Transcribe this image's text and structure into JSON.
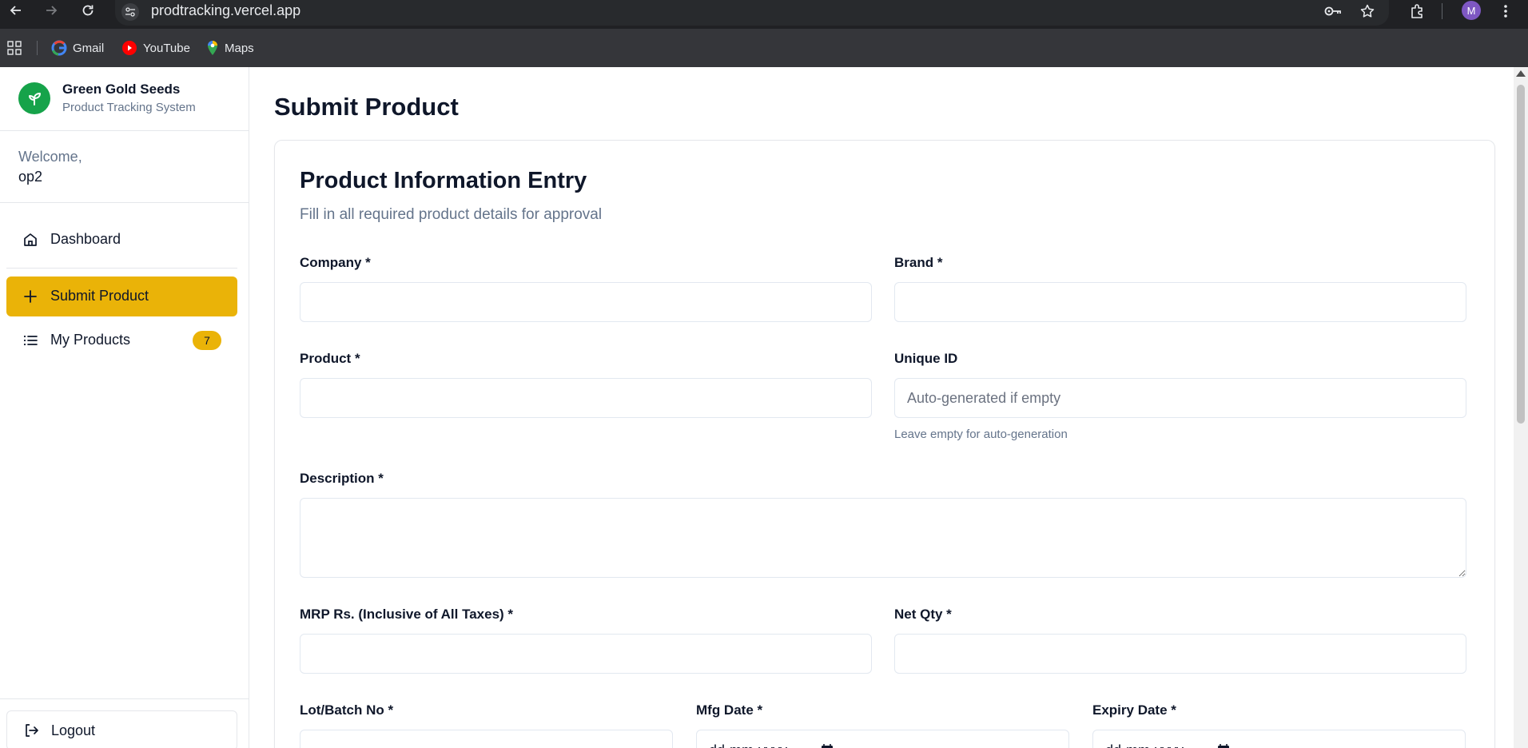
{
  "browser": {
    "url": "prodtracking.vercel.app",
    "profile_initial": "M",
    "bookmarks": [
      {
        "label": "Gmail",
        "icon": "gmail-icon"
      },
      {
        "label": "YouTube",
        "icon": "youtube-icon"
      },
      {
        "label": "Maps",
        "icon": "maps-icon"
      }
    ]
  },
  "sidebar": {
    "brand_name": "Green Gold Seeds",
    "brand_subtitle": "Product Tracking System",
    "welcome_label": "Welcome,",
    "username": "op2",
    "nav": {
      "dashboard": "Dashboard",
      "submit_product": "Submit Product",
      "my_products": "My Products",
      "my_products_count": "7"
    },
    "logout": "Logout"
  },
  "page": {
    "title": "Submit Product",
    "card_title": "Product Information Entry",
    "card_subtitle": "Fill in all required product details for approval"
  },
  "form": {
    "company": {
      "label": "Company *",
      "value": ""
    },
    "brand": {
      "label": "Brand *",
      "value": ""
    },
    "product": {
      "label": "Product *",
      "value": ""
    },
    "unique_id": {
      "label": "Unique ID",
      "placeholder": "Auto-generated if empty",
      "hint": "Leave empty for auto-generation"
    },
    "description": {
      "label": "Description *",
      "value": ""
    },
    "mrp": {
      "label": "MRP Rs. (Inclusive of All Taxes) *",
      "value": ""
    },
    "net_qty": {
      "label": "Net Qty *",
      "value": ""
    },
    "lot_batch": {
      "label": "Lot/Batch No *",
      "value": ""
    },
    "mfg_date": {
      "label": "Mfg Date *",
      "placeholder": "dd-mm-yyyy"
    },
    "expiry_date": {
      "label": "Expiry Date *",
      "placeholder": "dd-mm-yyyy"
    }
  },
  "colors": {
    "accent": "#eab308",
    "brand_green": "#16a34a",
    "muted_text": "#64748b",
    "border": "#e5e7eb"
  }
}
